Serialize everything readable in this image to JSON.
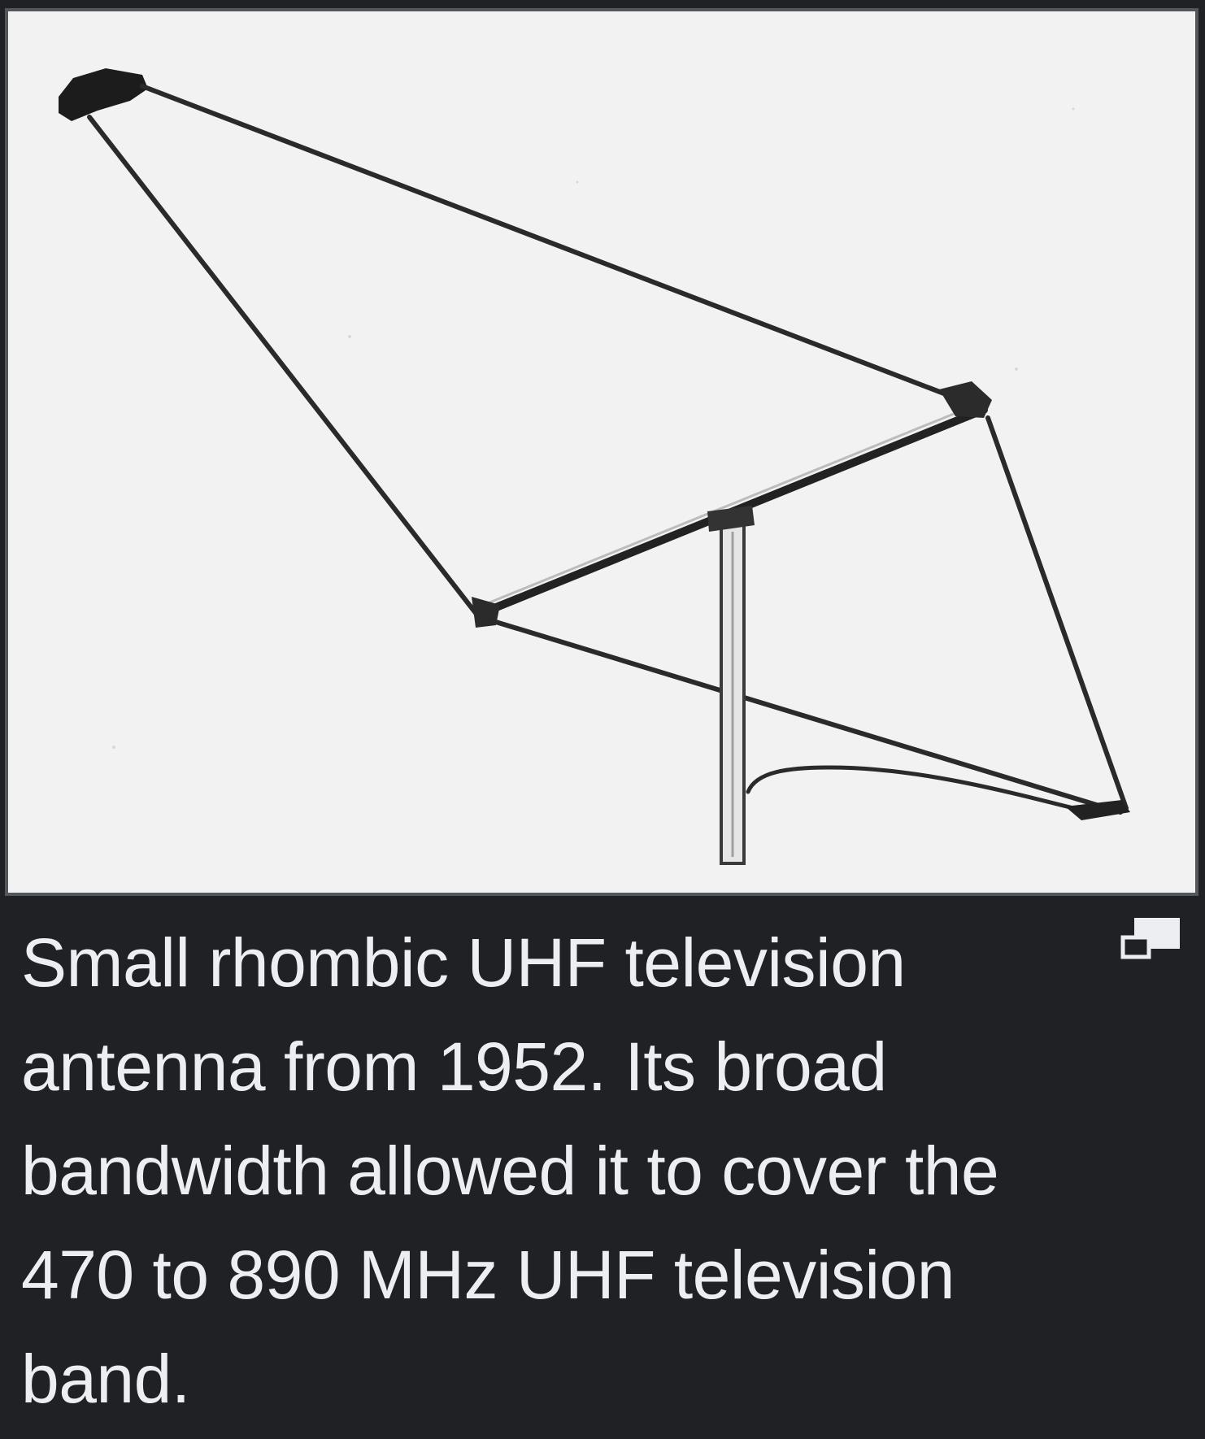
{
  "figure": {
    "image": {
      "subject": "rhombic-antenna-photo",
      "background_color": "#f1f1f1",
      "border_color": "#53565b"
    },
    "caption": "Small rhombic UHF television antenna from 1952. Its broad bandwidth allowed it to cover the 470 to 890 MHz UHF television band.",
    "enlarge_icon": "enlarge-icon",
    "colors": {
      "page_background": "#202124",
      "caption_text": "#eceef1"
    }
  }
}
